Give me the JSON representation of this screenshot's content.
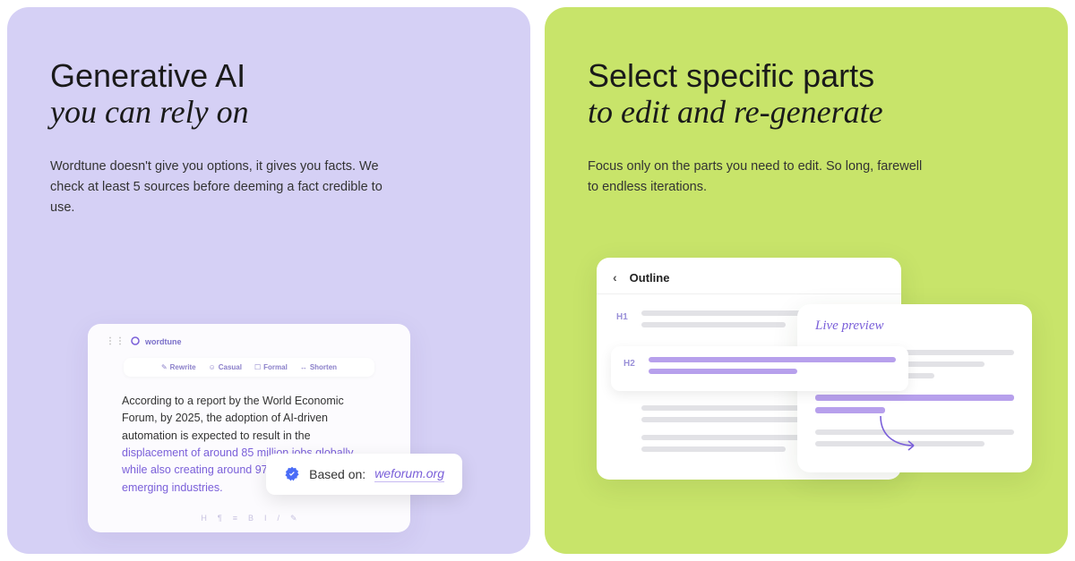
{
  "left": {
    "heading_bold": "Generative AI",
    "heading_italic": "you can rely on",
    "description": "Wordtune doesn't give you options, it gives you facts. We check at least 5 sources before deeming a fact credible to use.",
    "card": {
      "brand": "wordtune",
      "toolbar": {
        "rewrite": "Rewrite",
        "casual": "Casual",
        "formal": "Formal",
        "shorten": "Shorten"
      },
      "text_plain": "According to a report by the World Economic Forum, by 2025, the adoption of AI-driven automation is expected to result in the ",
      "text_highlight": "displacement of around 85 million jobs globally, while also creating around 97 million new jobs in emerging industries.",
      "source_label": "Based on:",
      "source_link": "weforum.org"
    }
  },
  "right": {
    "heading_bold": "Select specific parts",
    "heading_italic": "to edit and re-generate",
    "description": "Focus only on the parts you need to edit. So long, farewell to endless iterations.",
    "outline": {
      "title": "Outline",
      "h1": "H1",
      "h2": "H2"
    },
    "preview": {
      "title": "Live preview"
    }
  }
}
